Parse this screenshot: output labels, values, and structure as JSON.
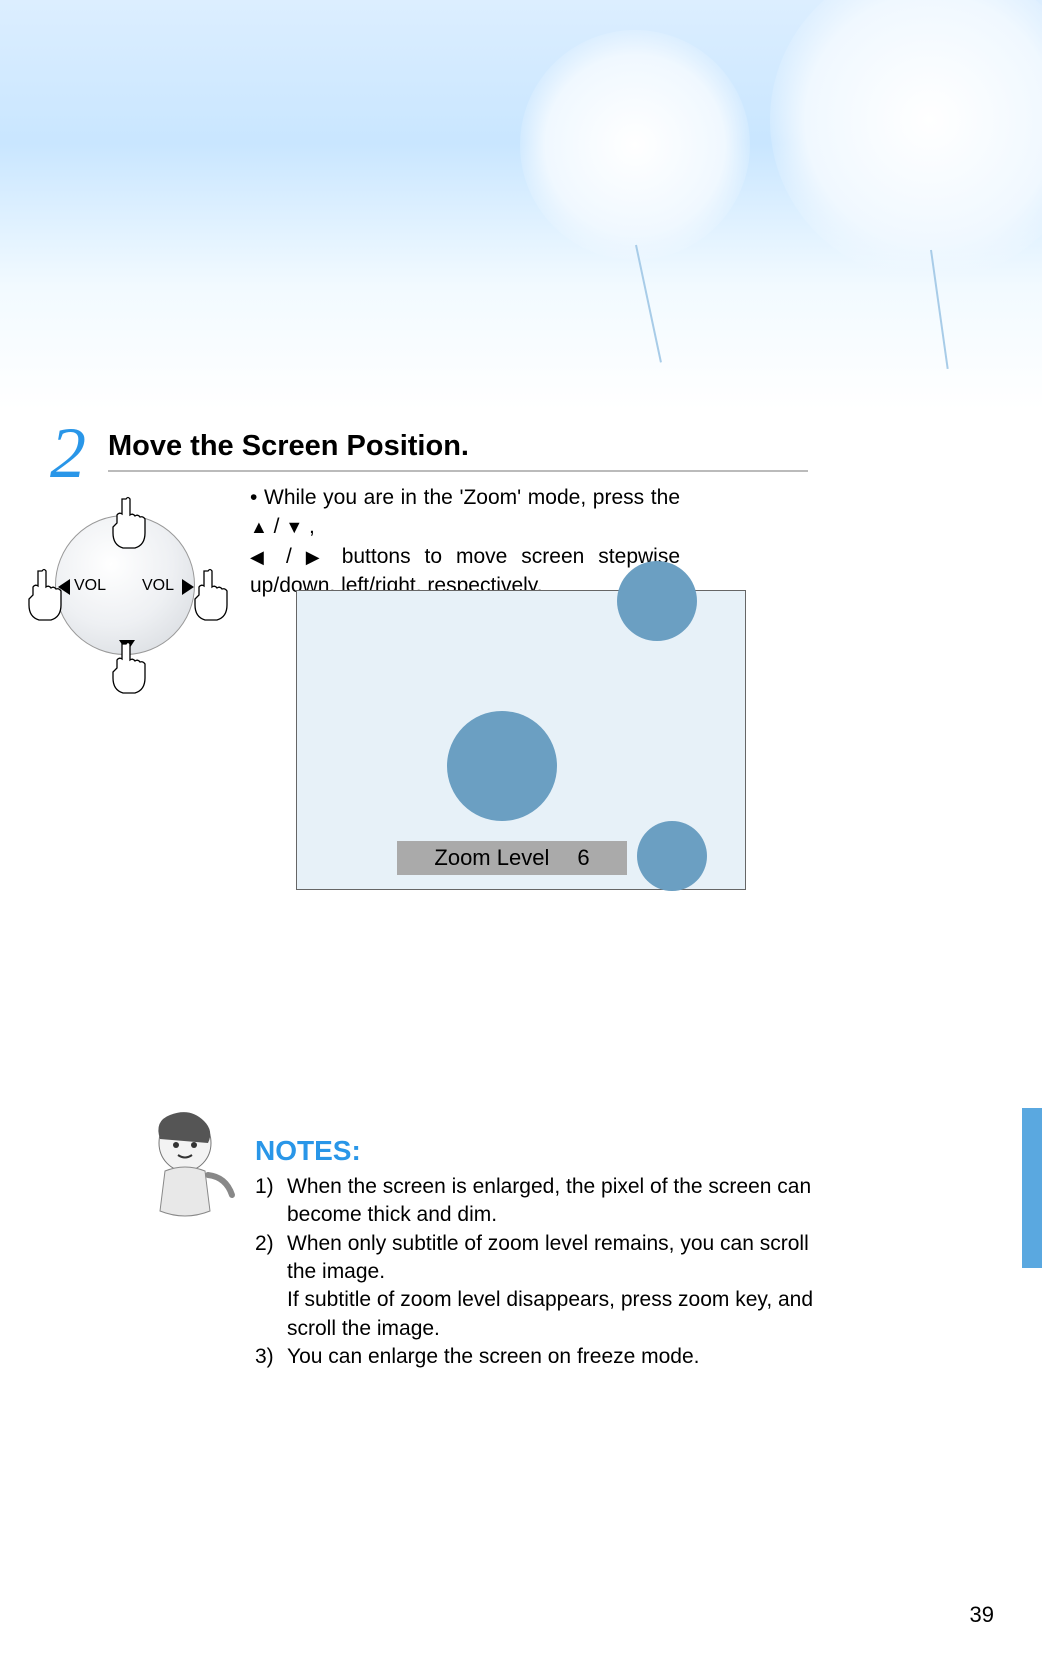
{
  "page_number": "39",
  "step": {
    "number": "2",
    "title": "Move the Screen Position.",
    "instruction_prefix": "• While you are in the 'Zoom' mode, press the ",
    "instruction_mid1": " / ",
    "instruction_mid2": " ,",
    "instruction_mid3": "/",
    "instruction_suffix": "buttons to move screen stepwise up/down, left/right, respectively."
  },
  "remote_pad": {
    "label_left": "VOL",
    "label_right": "VOL"
  },
  "screen_preview": {
    "zoom_label": "Zoom Level",
    "zoom_value": "6"
  },
  "notes": {
    "heading": "NOTES:",
    "items": [
      {
        "num": "1)",
        "text": "When the screen is enlarged, the pixel of the screen can become thick and dim."
      },
      {
        "num": "2)",
        "text": "When only subtitle of zoom level remains, you can scroll the image."
      },
      {
        "num": "",
        "text": "If subtitle of zoom level disappears, press zoom key, and scroll the image."
      },
      {
        "num": "3)",
        "text": "You can enlarge the screen on freeze mode."
      }
    ]
  }
}
